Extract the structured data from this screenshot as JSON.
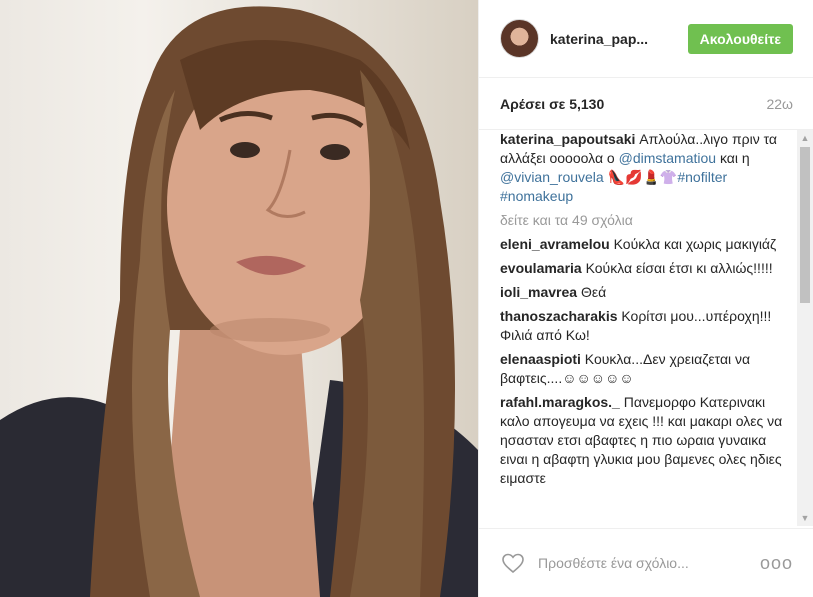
{
  "header": {
    "username": "katerina_pap...",
    "follow_label": "Ακολουθείτε"
  },
  "stats": {
    "likes": "Αρέσει σε 5,130",
    "time": "22ω"
  },
  "caption": {
    "user": "katerina_papoutsaki",
    "text_1": " Απλούλα..λιγο πριν τα αλλάξει οοοοολα ο ",
    "mention_1": "@dimstamatiou",
    "text_2": " και η ",
    "mention_2": "@vivian_rouvela",
    "text_3": " 👠💋💄👚",
    "tag_1": "#nofilter",
    "tag_2": "#nomakeup"
  },
  "view_all": "δείτε και τα 49 σχόλια",
  "comments": [
    {
      "user": "eleni_avramelou",
      "text": " Κούκλα και χωρις μακιγιάζ"
    },
    {
      "user": "evoulamaria",
      "text": " Κούκλα είσαι έτσι κι αλλιώς!!!!!"
    },
    {
      "user": "ioli_mavrea",
      "text": " Θεά"
    },
    {
      "user": "thanoszacharakis",
      "text": " Κορίτσι μου...υπέροχη!!! Φιλιά από Κω!"
    },
    {
      "user": "elenaaspioti",
      "text": " Κουκλα...Δεν χρειαζεται να βαφτεις....☺☺☺☺☺"
    },
    {
      "user": "rafahl.maragkos._",
      "text": " Πανεμορφο Κατερινακι καλο απογευμα να εχεις !!! και μακαρι ολες να ησασταν ετσι αβαφτες η πιο ωραια γυναικα ειναι η αβαφτη γλυκια μου βαμενες ολες ηδιες ειμαστε"
    }
  ],
  "footer": {
    "placeholder": "Προσθέστε ένα σχόλιο...",
    "more": "ooo"
  },
  "icons": {
    "heart": "heart-icon",
    "more": "more-options-icon",
    "avatar": "avatar"
  },
  "colors": {
    "follow": "#70c050",
    "link": "#3f729b",
    "muted": "#999999"
  }
}
